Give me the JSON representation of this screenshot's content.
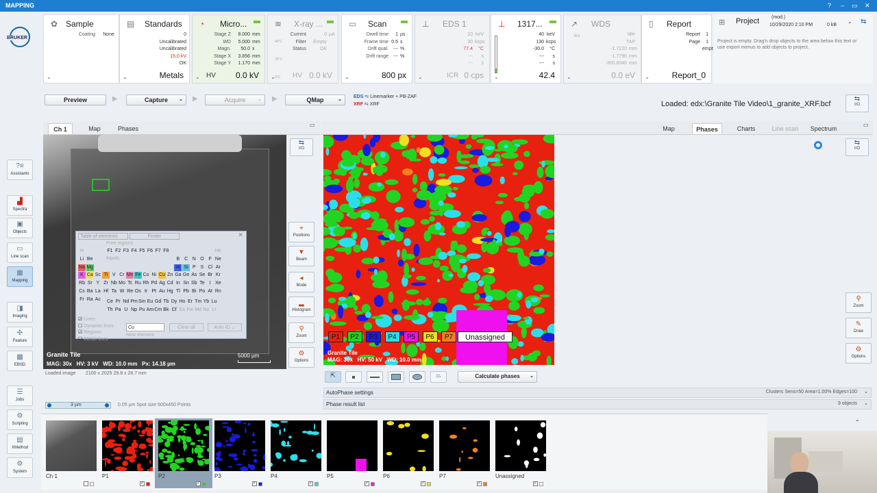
{
  "window": {
    "title": "MAPPING",
    "controls": [
      "?",
      "–",
      "▭",
      "✕"
    ]
  },
  "logo": {
    "text": "BRUKER"
  },
  "sidebar": {
    "items": [
      {
        "label": "Assistants",
        "icon": "assistants-icon",
        "glyph": "?≡"
      },
      {
        "label": "Spectra",
        "icon": "spectra-icon",
        "glyph": "▟"
      },
      {
        "label": "Objects",
        "icon": "objects-icon",
        "glyph": "▣"
      },
      {
        "label": "Line scan",
        "icon": "linescan-icon",
        "glyph": "▭"
      },
      {
        "label": "Mapping",
        "icon": "mapping-icon",
        "glyph": "▦"
      },
      {
        "label": "Imaging",
        "icon": "imaging-icon",
        "glyph": "◨"
      },
      {
        "label": "Feature",
        "icon": "feature-icon",
        "glyph": "✣"
      },
      {
        "label": "EBSD",
        "icon": "ebsd-icon",
        "glyph": "▩"
      },
      {
        "label": "Jobs",
        "icon": "jobs-icon",
        "glyph": "☰"
      },
      {
        "label": "Scripting",
        "icon": "scripting-icon",
        "glyph": "⚙"
      },
      {
        "label": "XMethod",
        "icon": "xmethod-icon",
        "glyph": "▤"
      },
      {
        "label": "System",
        "icon": "system-icon",
        "glyph": "⚙"
      }
    ]
  },
  "panels": {
    "sample": {
      "title": "Sample",
      "rows": [
        [
          "Coating",
          "None"
        ]
      ]
    },
    "standards": {
      "title": "Standards",
      "vals": [
        "0",
        "Uncalibrated",
        "Uncalibrated",
        "15.0 kV",
        "OK"
      ],
      "bottom": "Metals"
    },
    "micro": {
      "title": "Micro...",
      "rows": [
        [
          "Stage Z",
          "8.000",
          "mm"
        ],
        [
          "WD",
          "5.000",
          "mm"
        ],
        [
          "Magn.",
          "50.0",
          "x"
        ],
        [
          "Stage X",
          "3.856",
          "mm"
        ],
        [
          "Stage Y",
          "1.170",
          "mm"
        ]
      ],
      "bottom_label": "HV",
      "bottom": "0.0 kV"
    },
    "xray": {
      "title": "X-ray ...",
      "rows": [
        [
          "Current",
          "0",
          "µA"
        ],
        [
          "Filter",
          "Empty",
          ""
        ],
        [
          "Status",
          "OK",
          ""
        ]
      ],
      "scale": [
        "40°C",
        "30°C",
        "0°C"
      ],
      "bottom_label": "HV",
      "bottom": "0.0 kV"
    },
    "scan": {
      "title": "Scan",
      "rows": [
        [
          "Dwell time",
          "1",
          "µs"
        ],
        [
          "Frame time",
          "0.5",
          "s"
        ],
        [
          "Drift qual.",
          "---",
          "%"
        ],
        [
          "Drift range",
          "---",
          "%"
        ]
      ],
      "bottom": "800 px"
    },
    "eds1": {
      "title": "EDS 1",
      "rows": [
        [
          "10",
          "keV"
        ],
        [
          "30",
          "kcps"
        ],
        [
          "77.4",
          "°C"
        ],
        [
          "---",
          "s"
        ],
        [
          "---",
          "s"
        ]
      ],
      "bottom_label": "ICR",
      "bottom": "0 cps"
    },
    "det1317": {
      "title": "1317...",
      "rows": [
        [
          "40",
          "keV"
        ],
        [
          "130",
          "kcps"
        ],
        [
          "-30.0",
          "°C"
        ],
        [
          "---",
          "s"
        ],
        [
          "---",
          "s"
        ]
      ],
      "bottom": "42.4"
    },
    "wds": {
      "title": "WDS",
      "rows": [
        [
          "Idle"
        ],
        [
          "TAP"
        ],
        [
          "-1.7220",
          "mm"
        ],
        [
          "-1.7790",
          "mm"
        ],
        [
          "-300.6040",
          "mm"
        ]
      ],
      "side": "3EX",
      "bottom": "0.0 eV"
    },
    "report": {
      "title": "Report",
      "rows": [
        [
          "Report",
          "1"
        ],
        [
          "Page",
          "1"
        ],
        [
          "",
          "empty"
        ]
      ],
      "bottom": "Report_0"
    },
    "project": {
      "title": "Project",
      "mod": "(mod.)",
      "date": "10/29/2020 2:10 PM",
      "size": "0 kB",
      "hint": "Project is empty. Drag'n drop objects to the area below this text or use export menus to add objects to project."
    }
  },
  "toolbar": {
    "preview": "Preview",
    "capture": "Capture",
    "acquire": "Acquire",
    "qmap": "QMap",
    "eds_tag": "EDS",
    "eds_method": "Linemarker + PB-ZAF",
    "xrf_tag": "XRF",
    "xrf_method": "XRF",
    "loaded": "Loaded: edx:\\Granite Tile Video\\1_granite_XRF.bcf",
    "io": "I/O"
  },
  "left_tabs": [
    "Ch 1",
    "Map",
    "Phases"
  ],
  "right_tabs": [
    "Map",
    "Phases",
    "Charts",
    "Line scan",
    "Spectrum"
  ],
  "sem": {
    "name": "Granite Tile",
    "mag": "MAG: 30x",
    "hv": "HV: 3 kV",
    "wd": "WD: 10.0 mm",
    "px": "Px: 14.18 µm",
    "scalebar": "5000 µm",
    "loaded_image": "Loaded image",
    "dims": "2100 x 2025  29.8 x 28.7 mm"
  },
  "ptable": {
    "tab1": "Table of elements",
    "tab2": "Finder",
    "free_regions": "Free regions",
    "inputs": "Inputs",
    "chk_lines": "Lines",
    "chk_dyn": "Dynamic lines",
    "chk_regions": "Regions",
    "chk_ebsd": "EBSD lines",
    "input": "Cu",
    "clear": "Clear all",
    "autoid": "Auto ID",
    "new_element": "New element",
    "rows": [
      [
        "H",
        "",
        "",
        "",
        "",
        "",
        "",
        "",
        "",
        "",
        "",
        "",
        "",
        "",
        "",
        "",
        "",
        "He"
      ],
      [
        "Li",
        "Be",
        "",
        "",
        "",
        "",
        "",
        "",
        "",
        "",
        "",
        "",
        "B",
        "C",
        "N",
        "O",
        "F",
        "Ne"
      ],
      [
        "Na",
        "Mg",
        "",
        "",
        "",
        "",
        "",
        "",
        "",
        "",
        "",
        "",
        "Al",
        "Si",
        "P",
        "S",
        "Cl",
        "Ar"
      ],
      [
        "K",
        "Ca",
        "Sc",
        "Ti",
        "V",
        "Cr",
        "Mn",
        "Fe",
        "Co",
        "Ni",
        "Cu",
        "Zn",
        "Ga",
        "Ge",
        "As",
        "Se",
        "Br",
        "Kr"
      ],
      [
        "Rb",
        "Sr",
        "Y",
        "Zr",
        "Nb",
        "Mo",
        "Tc",
        "Ru",
        "Rh",
        "Pd",
        "Ag",
        "Cd",
        "In",
        "Sn",
        "Sb",
        "Te",
        "I",
        "Xe"
      ],
      [
        "Cs",
        "Ba",
        "La",
        "Hf",
        "Ta",
        "W",
        "Re",
        "Os",
        "Ir",
        "Pt",
        "Au",
        "Hg",
        "Tl",
        "Pb",
        "Bi",
        "Po",
        "At",
        "Rn"
      ],
      [
        "Fr",
        "Ra",
        "Ac",
        "",
        "",
        "",
        "",
        "",
        "",
        "",
        "",
        "",
        "",
        "",
        "",
        "",
        "",
        ""
      ]
    ],
    "lanth": [
      "Ce",
      "Pr",
      "Nd",
      "Pm",
      "Sm",
      "Eu",
      "Gd",
      "Tb",
      "Dy",
      "Ho",
      "Er",
      "Tm",
      "Yb",
      "Lu"
    ],
    "actin": [
      "Th",
      "Pa",
      "U",
      "Np",
      "Pu",
      "Am",
      "Cm",
      "Bk",
      "Cf",
      "Es",
      "Fm",
      "Md",
      "No",
      "Lr"
    ],
    "fkeys": [
      "F1",
      "F2",
      "F3",
      "F4",
      "F5",
      "F6",
      "F7",
      "F8"
    ]
  },
  "right_tools": [
    {
      "label": "I/O",
      "icon": "io-icon"
    },
    {
      "label": "Positions",
      "icon": "positions-icon"
    },
    {
      "label": "Beam",
      "icon": "beam-icon"
    },
    {
      "label": "Mode",
      "icon": "mode-icon"
    },
    {
      "label": "Histogram",
      "icon": "histogram-icon"
    },
    {
      "label": "Zoom",
      "icon": "zoom-icon"
    },
    {
      "label": "Options",
      "icon": "options-icon"
    }
  ],
  "phase_tools": [
    {
      "label": "Zoom",
      "icon": "zoom-icon"
    },
    {
      "label": "Draw",
      "icon": "draw-icon"
    },
    {
      "label": "Options",
      "icon": "options-icon"
    }
  ],
  "phasemap": {
    "name": "Granite Tile",
    "mag": "MAG: 30x",
    "hv": "HV: 50 kV",
    "wd": "WD: 10.0 mm",
    "legend": [
      {
        "label": "P1",
        "color": "#e82010"
      },
      {
        "label": "P2",
        "color": "#22d422"
      },
      {
        "label": "P3",
        "color": "#1a1ae0"
      },
      {
        "label": "P4",
        "color": "#2ae0e8"
      },
      {
        "label": "P5",
        "color": "#ee10ee"
      },
      {
        "label": "P6",
        "color": "#f0e020"
      },
      {
        "label": "P7",
        "color": "#f08020"
      },
      {
        "label": "Unassigned",
        "color": "#ffffff"
      }
    ]
  },
  "phase_controls": {
    "calc": "Calculate phases",
    "autophase": "AutoPhase settings",
    "autophase_info": "Clusters  Sens=50  Area=1.00%  Edges=100",
    "result": "Phase result list",
    "result_info": "9 objects"
  },
  "bottom_status": {
    "spot": "3 µm",
    "info": "0.05 µm Spot size   600x450 Points"
  },
  "thumbnails": [
    {
      "label": "Ch 1",
      "color": "#888888"
    },
    {
      "label": "P1",
      "color": "#e82010"
    },
    {
      "label": "P2",
      "color": "#22d422"
    },
    {
      "label": "P3",
      "color": "#1a1ae0"
    },
    {
      "label": "P4",
      "color": "#2ae0e8"
    },
    {
      "label": "P5",
      "color": "#ee10ee"
    },
    {
      "label": "P6",
      "color": "#f0e020"
    },
    {
      "label": "P7",
      "color": "#f08020"
    },
    {
      "label": "Unassigned",
      "color": "#ffffff"
    }
  ]
}
